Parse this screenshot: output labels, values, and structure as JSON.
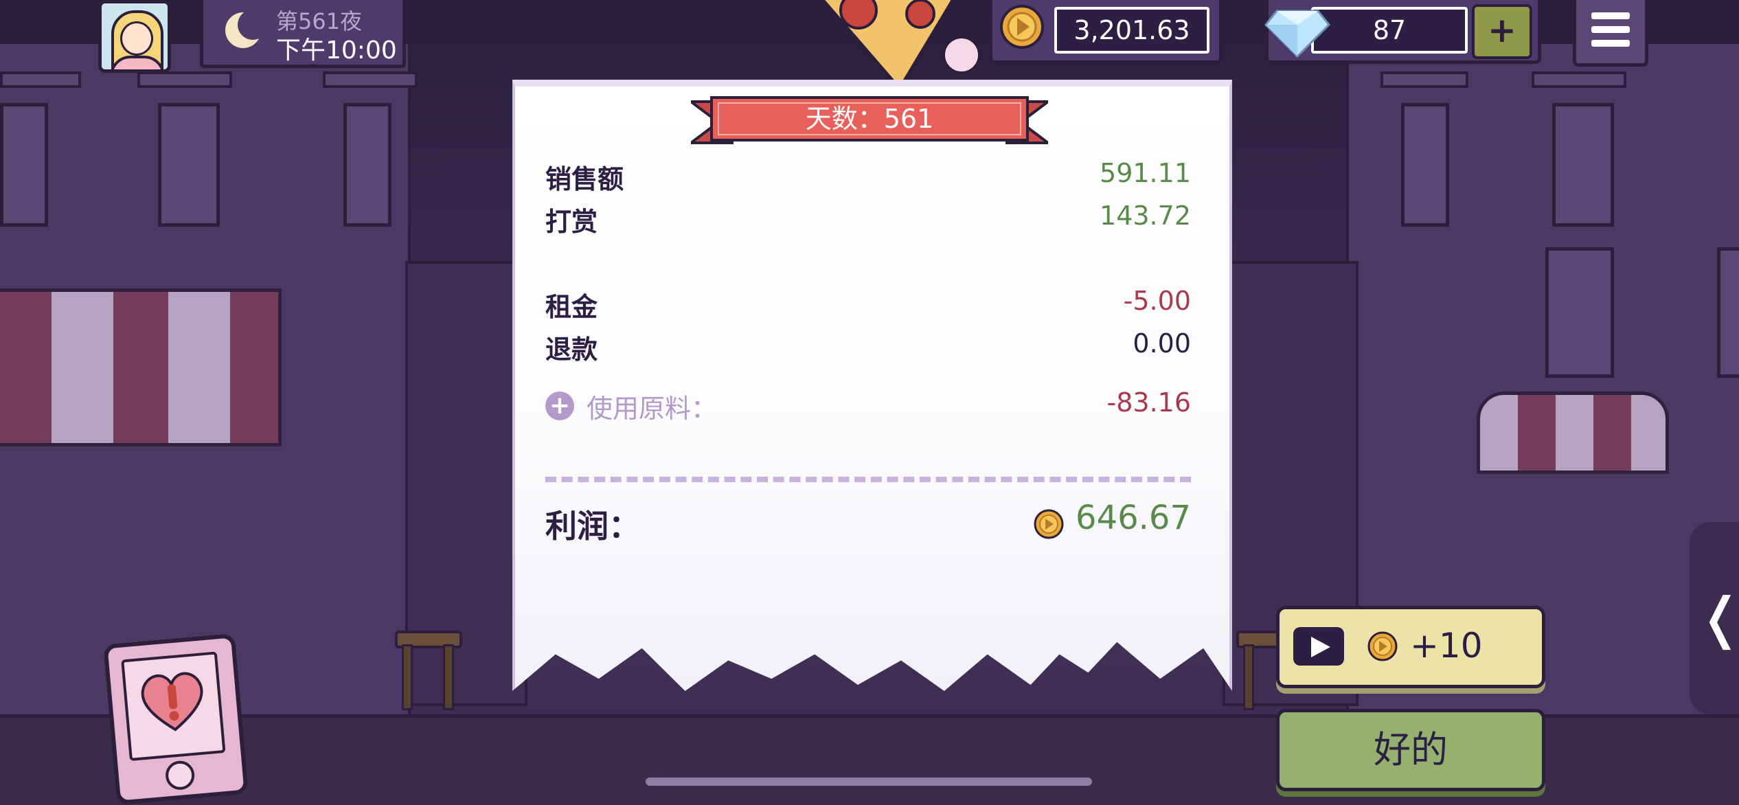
{
  "hud": {
    "night_label": "第561夜",
    "time": "下午10:00",
    "coins": "3,201.63",
    "gems": "87",
    "plus_label": "+"
  },
  "receipt": {
    "day_banner": "天数：561",
    "rows": [
      {
        "label": "销售额",
        "value": "591.11",
        "tone": "positive"
      },
      {
        "label": "打赏",
        "value": "143.72",
        "tone": "positive"
      },
      {
        "label": "租金",
        "value": "-5.00",
        "tone": "negative"
      },
      {
        "label": "退款",
        "value": "0.00",
        "tone": "neutral"
      }
    ],
    "materials": {
      "label": "使用原料：",
      "value": "-83.16",
      "expand_glyph": "+"
    },
    "profit": {
      "label": "利润：",
      "value": "646.67"
    }
  },
  "buttons": {
    "ad_reward": "+10",
    "ok": "好的",
    "side_tab_glyph": "❬"
  },
  "icons": [
    "avatar",
    "moon-icon",
    "coin-icon",
    "gem-icon",
    "menu-icon",
    "play-icon",
    "heart-alert-icon"
  ],
  "colors": {
    "positive": "#5a8a4a",
    "negative": "#a83a4e",
    "banner": "#e8605a",
    "ok_button": "#96b070",
    "ad_button": "#ede3a8"
  }
}
